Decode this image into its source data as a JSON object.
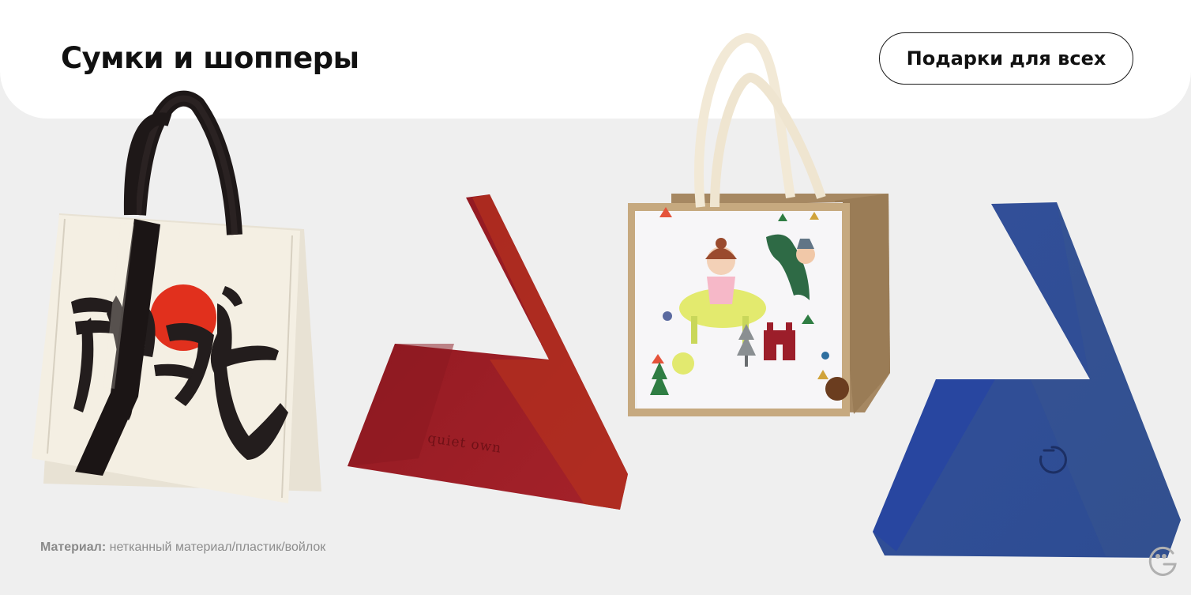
{
  "page": {
    "title": "Сумки и шопперы",
    "category_button": "Подарки для всех",
    "material_label": "Материал:",
    "material_value": " нетканный материал/пластик/войлок"
  },
  "bags": [
    {
      "name": "canvas-calligraphy-tote",
      "print_text": "搞钱"
    },
    {
      "name": "red-felt-triangle-bag",
      "print_text": "quiet own"
    },
    {
      "name": "jute-kids-print-bag"
    },
    {
      "name": "blue-felt-triangle-bag"
    }
  ],
  "colors": {
    "background": "#efefef",
    "header": "#ffffff",
    "text": "#111111",
    "muted": "#8c8c8c",
    "red_bag": "#9e1c24",
    "blue_bag": "#2c4a96",
    "jute": "#a88a62"
  },
  "icons": [
    "brand-logo-icon"
  ]
}
